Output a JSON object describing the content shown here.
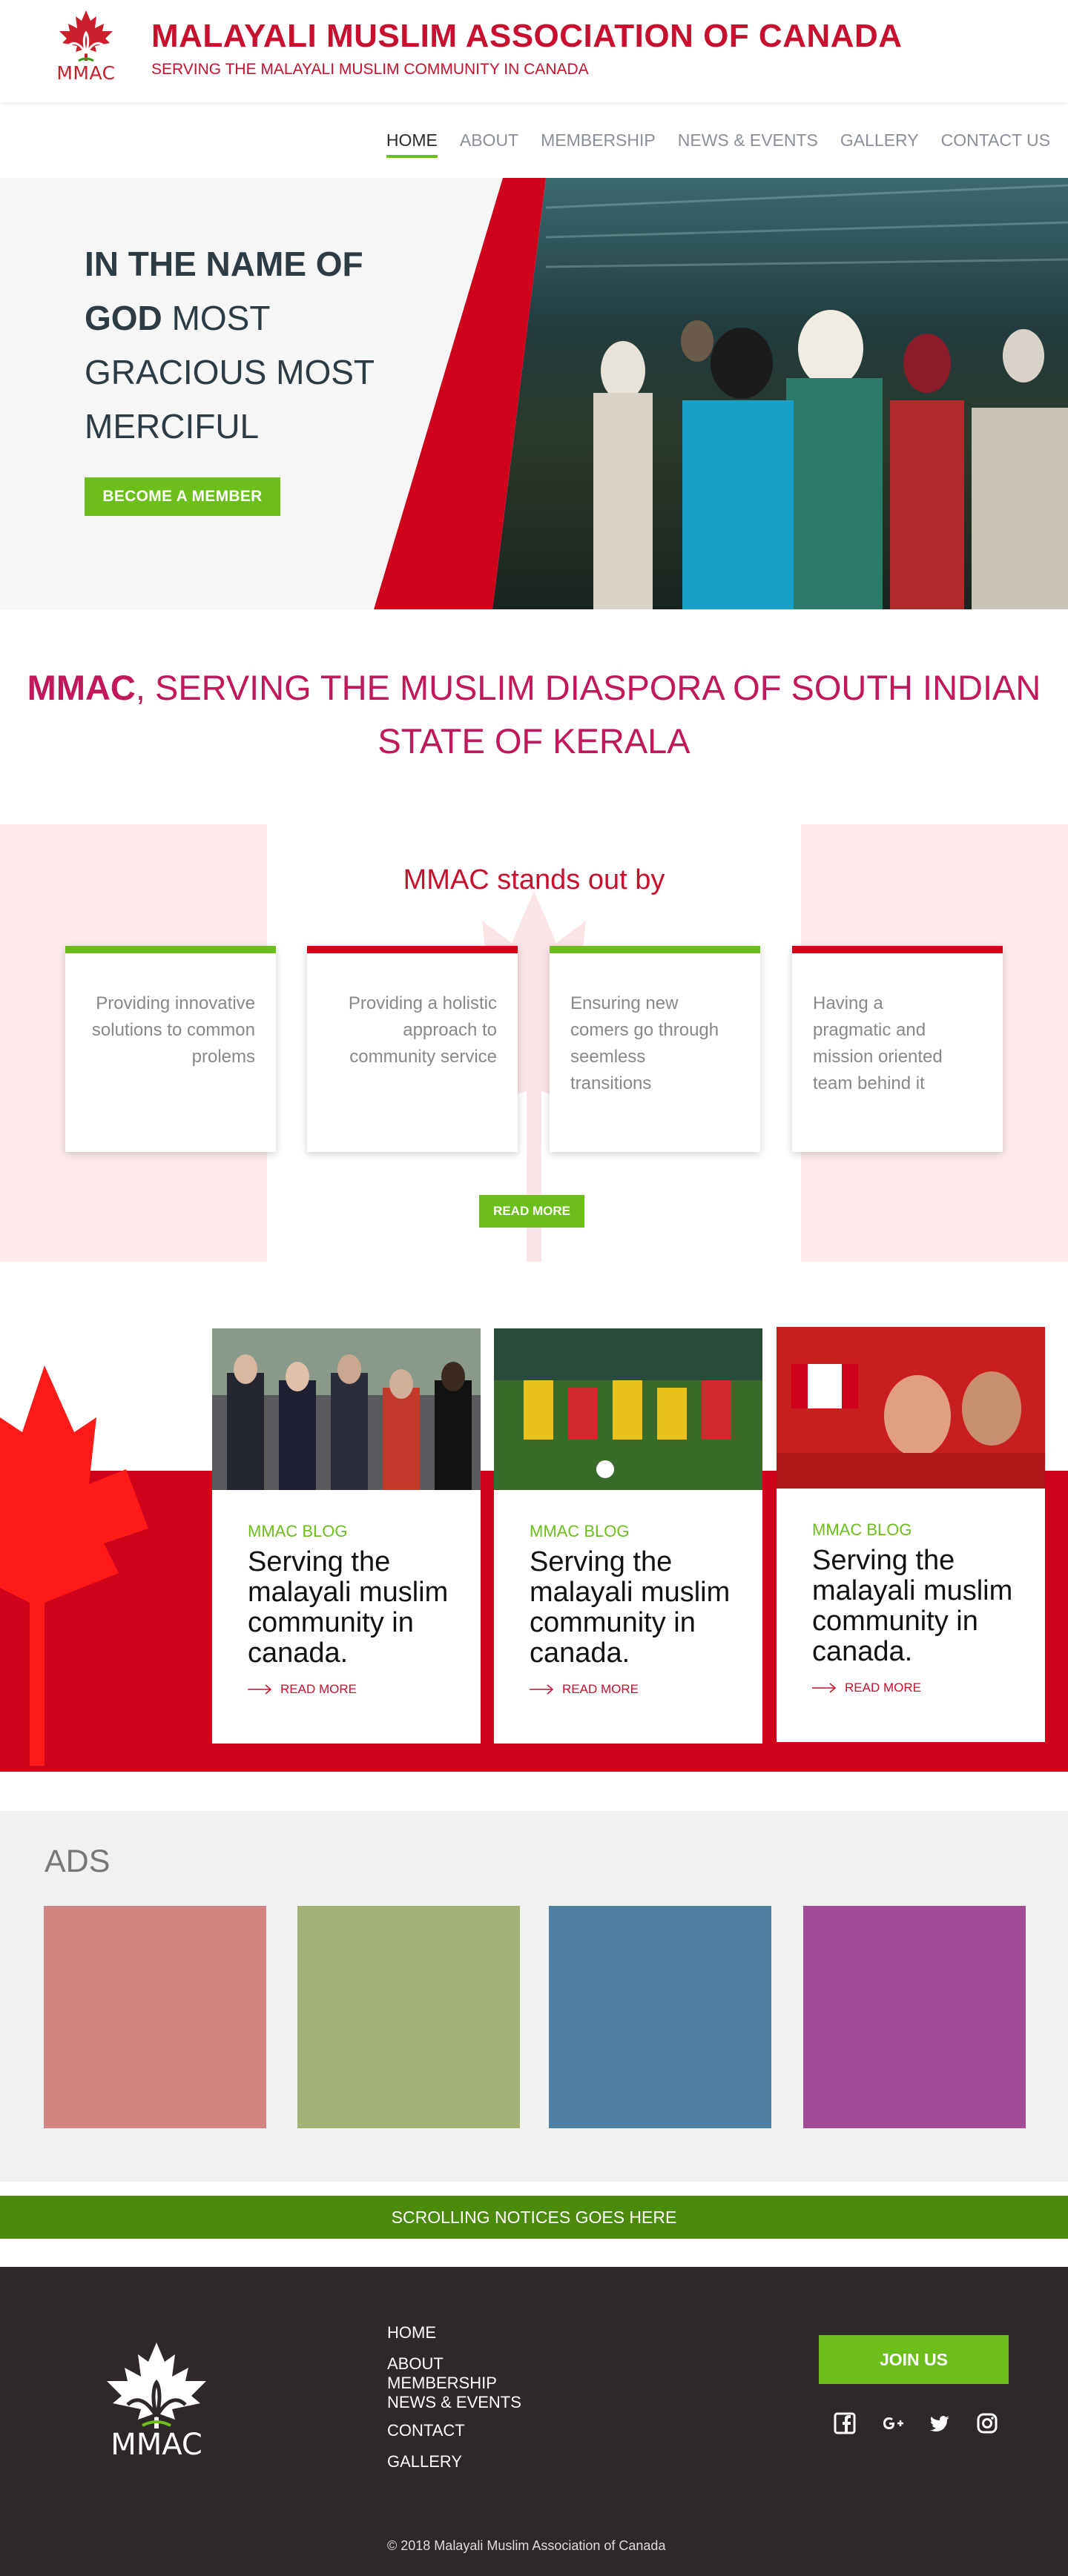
{
  "header": {
    "logo_text": "MMAC",
    "org_name": "MALAYALI MUSLIM ASSOCIATION OF CANADA",
    "tagline": "SERVING THE MALAYALI MUSLIM COMMUNITY IN CANADA"
  },
  "nav": {
    "items": [
      {
        "label": "HOME",
        "active": true
      },
      {
        "label": "ABOUT"
      },
      {
        "label": "MEMBERSHIP"
      },
      {
        "label": "NEWS & EVENTS"
      },
      {
        "label": "GALLERY"
      },
      {
        "label": "CONTACT US"
      }
    ]
  },
  "hero": {
    "title_bold": "IN THE NAME OF GOD",
    "title_rest": "MOST GRACIOUS MOST MERCIFUL",
    "button": "BECOME A MEMBER"
  },
  "mission": {
    "bold": "MMAC",
    "text": ", SERVING THE MUSLIM DIASPORA OF  SOUTH INDIAN STATE OF KERALA"
  },
  "stands_out": {
    "title": "MMAC stands out by",
    "cards": [
      {
        "text": "Providing innovative solutions to common prolems",
        "accent": "#6cbf1a"
      },
      {
        "text": "Providing a holistic approach  to community service",
        "accent": "#d0021b"
      },
      {
        "text": "Ensuring new comers go through seemless transitions",
        "accent": "#6cbf1a"
      },
      {
        "text": "Having a pragmatic and mission oriented team behind it",
        "accent": "#d0021b"
      }
    ],
    "button": "READ MORE"
  },
  "blog": {
    "posts": [
      {
        "category": "MMAC BLOG",
        "title": "Serving the malayali muslim community in canada.",
        "more": "READ MORE",
        "image": "politicians-gathering-photo"
      },
      {
        "category": "MMAC BLOG",
        "title": "Serving the malayali muslim community in canada.",
        "more": "READ MORE",
        "image": "kids-soccer-photo"
      },
      {
        "category": "MMAC BLOG",
        "title": "Serving the malayali muslim community in canada.",
        "more": "READ MORE",
        "image": "girls-with-canada-flags-photo"
      }
    ]
  },
  "ads": {
    "title": "ADS",
    "colors": [
      "#d38482",
      "#a4b275",
      "#4e80a2",
      "#a24b97"
    ]
  },
  "notice": {
    "text": "SCROLLING NOTICES GOES HERE"
  },
  "footer": {
    "logo_text": "MMAC",
    "links": [
      "HOME",
      "ABOUT",
      "MEMBERSHIP",
      "NEWS & EVENTS",
      "CONTACT",
      "GALLERY"
    ],
    "join_button": "JOIN US",
    "socials": [
      "facebook-icon",
      "google-plus-icon",
      "twitter-icon",
      "instagram-icon"
    ],
    "copyright": "© 2018 Malayali Muslim Association of Canada"
  },
  "colors": {
    "brand_red": "#c8102e",
    "brand_green": "#6cbf1a",
    "mission_pink": "#c2185b",
    "notice_green": "#4c8a0b",
    "footer_bg": "#2f2828"
  }
}
